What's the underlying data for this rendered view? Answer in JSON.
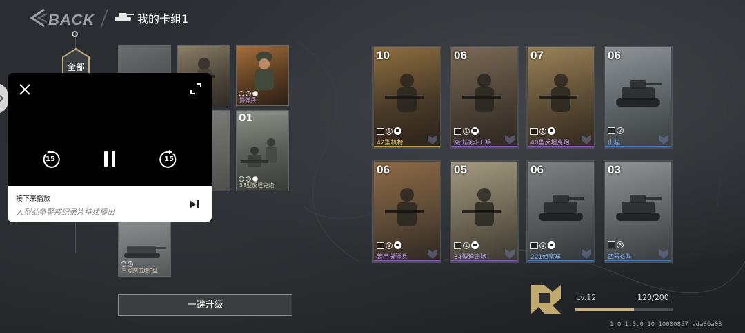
{
  "header": {
    "back_label": "BACK",
    "deck_title": "我的卡组1"
  },
  "filter": {
    "all_label": "全部"
  },
  "left_cards": [
    {
      "name": "",
      "cost": ""
    },
    {
      "name": "",
      "cost": ""
    },
    {
      "name": "掷弹兵",
      "cost": ""
    },
    {
      "name": "38型反坦克炮",
      "cost": "01"
    },
    {
      "name": "三号突击炮E型",
      "cost": ""
    }
  ],
  "deck_cards": [
    {
      "cost": "10",
      "stat_num": "1",
      "name": "42型机枪",
      "rarity_color": "#c9a23a"
    },
    {
      "cost": "06",
      "stat_num": "1",
      "name": "突击战斗工兵",
      "rarity_color": "#8a55d6"
    },
    {
      "cost": "07",
      "stat_num": "2",
      "name": "40型反坦克炮",
      "rarity_color": "#8a55d6"
    },
    {
      "cost": "06",
      "stat_num": "2",
      "name": "山猫",
      "rarity_color": "#3f7fd6"
    },
    {
      "cost": "06",
      "stat_num": "1",
      "name": "装甲掷弹兵",
      "rarity_color": "#8a55d6"
    },
    {
      "cost": "05",
      "stat_num": "1",
      "name": "34型迫击炮",
      "rarity_color": "#8a55d6"
    },
    {
      "cost": "06",
      "stat_num": "1",
      "name": "221侦察车",
      "rarity_color": "#3f7fd6"
    },
    {
      "cost": "03",
      "stat_num": "3",
      "name": "四号G型",
      "rarity_color": "#3f7fd6"
    }
  ],
  "upgrade_button": "一键升级",
  "level": {
    "label": "Lv.12",
    "xp_text": "120/200",
    "progress": 0.6
  },
  "build_id": "1_0_1.0.0_10_10000857_ada36a03",
  "video_overlay": {
    "next_label": "接下来播放",
    "next_title": "大型战争警戒纪录片持续播出",
    "skip_back": "15",
    "skip_forward": "15"
  },
  "colors": {
    "accent_gold": "#c8b27a",
    "rarity_gold": "#c9a23a",
    "rarity_purple": "#8a55d6",
    "rarity_blue": "#3f7fd6"
  }
}
